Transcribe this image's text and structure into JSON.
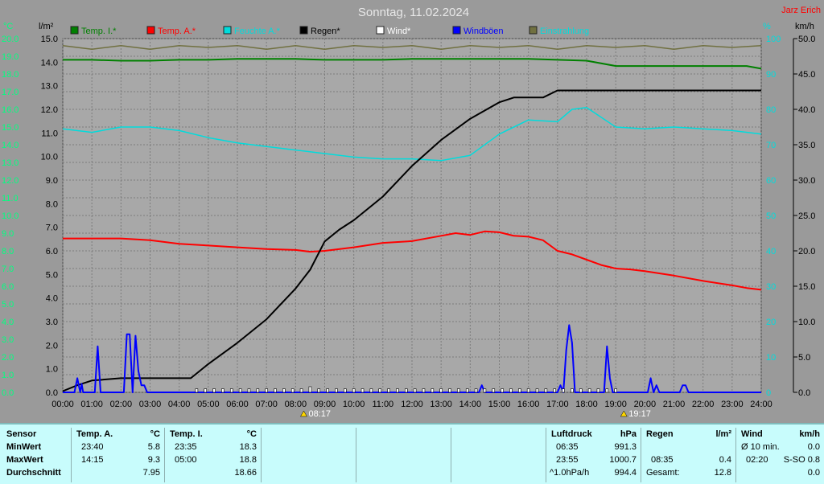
{
  "title": "Sonntag, 11.02.2024",
  "brand": "Jarz Erich",
  "colors": {
    "temp_i": "#008000",
    "temp_a": "#ff0000",
    "feuchte": "#00dcdc",
    "regen": "#000000",
    "wind": "#ffffff",
    "windboeen": "#0000ff",
    "einstrahlung": "#707040",
    "plot_bg": "#a8a8a8",
    "grid": "#7c7c7c"
  },
  "chart_data": {
    "type": "line",
    "title": "Sonntag, 11.02.2024",
    "x_range": [
      0,
      24
    ],
    "x_ticks": [
      "00:00",
      "01:00",
      "02:00",
      "03:00",
      "04:00",
      "05:00",
      "06:00",
      "07:00",
      "08:00",
      "09:00",
      "10:00",
      "11:00",
      "12:00",
      "13:00",
      "14:00",
      "15:00",
      "16:00",
      "17:00",
      "18:00",
      "19:00",
      "20:00",
      "21:00",
      "22:00",
      "23:00",
      "24:00"
    ],
    "axes": {
      "temp_c": {
        "unit": "°C",
        "range": [
          0,
          20
        ],
        "ticks": [
          "0.0",
          "1.0",
          "2.0",
          "3.0",
          "4.0",
          "5.0",
          "6.0",
          "7.0",
          "8.0",
          "9.0",
          "10.0",
          "11.0",
          "12.0",
          "13.0",
          "14.0",
          "15.0",
          "16.0",
          "17.0",
          "18.0",
          "19.0",
          "20.0"
        ]
      },
      "rain_lm2": {
        "unit": "l/m²",
        "range": [
          0,
          15
        ],
        "ticks": [
          "0.0",
          "1.0",
          "2.0",
          "3.0",
          "4.0",
          "5.0",
          "6.0",
          "7.0",
          "8.0",
          "9.0",
          "10.0",
          "11.0",
          "12.0",
          "13.0",
          "14.0",
          "15.0"
        ]
      },
      "humidity_pct": {
        "unit": "%",
        "range": [
          0,
          100
        ],
        "ticks": [
          "0",
          "10",
          "20",
          "30",
          "40",
          "50",
          "60",
          "70",
          "80",
          "90",
          "100"
        ]
      },
      "wind_kmh": {
        "unit": "km/h",
        "range": [
          0,
          50
        ],
        "ticks": [
          "0.0",
          "5.0",
          "10.0",
          "15.0",
          "20.0",
          "25.0",
          "30.0",
          "35.0",
          "40.0",
          "45.0",
          "50.0"
        ]
      }
    },
    "grid": true,
    "legend_position": "top",
    "series": [
      {
        "name": "Temp. I.*",
        "axis": "temp_c",
        "color": "#008000",
        "points": [
          [
            0,
            18.8
          ],
          [
            1,
            18.8
          ],
          [
            2,
            18.75
          ],
          [
            3,
            18.75
          ],
          [
            4,
            18.8
          ],
          [
            5,
            18.8
          ],
          [
            6,
            18.85
          ],
          [
            7,
            18.85
          ],
          [
            8,
            18.85
          ],
          [
            9,
            18.8
          ],
          [
            10,
            18.8
          ],
          [
            11,
            18.8
          ],
          [
            12,
            18.85
          ],
          [
            13,
            18.85
          ],
          [
            14,
            18.85
          ],
          [
            15,
            18.85
          ],
          [
            16,
            18.85
          ],
          [
            17,
            18.8
          ],
          [
            18,
            18.75
          ],
          [
            19,
            18.45
          ],
          [
            20,
            18.45
          ],
          [
            21,
            18.45
          ],
          [
            22,
            18.45
          ],
          [
            23,
            18.45
          ],
          [
            23.5,
            18.45
          ],
          [
            24,
            18.3
          ]
        ]
      },
      {
        "name": "Temp. A.*",
        "axis": "temp_c",
        "color": "#ff0000",
        "points": [
          [
            0,
            8.7
          ],
          [
            1,
            8.7
          ],
          [
            2,
            8.7
          ],
          [
            3,
            8.6
          ],
          [
            4,
            8.4
          ],
          [
            5,
            8.3
          ],
          [
            6,
            8.2
          ],
          [
            7,
            8.1
          ],
          [
            8,
            8.05
          ],
          [
            8.5,
            7.95
          ],
          [
            9,
            8.0
          ],
          [
            10,
            8.2
          ],
          [
            11,
            8.45
          ],
          [
            12,
            8.55
          ],
          [
            13,
            8.85
          ],
          [
            13.5,
            9.0
          ],
          [
            14,
            8.9
          ],
          [
            14.5,
            9.1
          ],
          [
            15,
            9.05
          ],
          [
            15.5,
            8.85
          ],
          [
            16,
            8.8
          ],
          [
            16.5,
            8.6
          ],
          [
            17,
            8.0
          ],
          [
            17.5,
            7.8
          ],
          [
            18,
            7.5
          ],
          [
            18.5,
            7.2
          ],
          [
            19,
            7.0
          ],
          [
            19.5,
            6.95
          ],
          [
            20,
            6.85
          ],
          [
            21,
            6.6
          ],
          [
            22,
            6.3
          ],
          [
            23,
            6.05
          ],
          [
            23.5,
            5.9
          ],
          [
            24,
            5.8
          ]
        ]
      },
      {
        "name": "Feuchte A.*",
        "axis": "humidity_pct",
        "color": "#00dcdc",
        "points": [
          [
            0,
            74.5
          ],
          [
            1,
            73.5
          ],
          [
            2,
            75
          ],
          [
            3,
            75
          ],
          [
            4,
            74
          ],
          [
            5,
            72
          ],
          [
            6,
            70.5
          ],
          [
            7,
            69.5
          ],
          [
            8,
            68.5
          ],
          [
            9,
            67.5
          ],
          [
            10,
            66.5
          ],
          [
            11,
            66
          ],
          [
            12,
            66
          ],
          [
            13,
            65.5
          ],
          [
            14,
            67
          ],
          [
            15,
            73
          ],
          [
            16,
            77
          ],
          [
            17,
            76.5
          ],
          [
            17.5,
            80
          ],
          [
            18,
            80.5
          ],
          [
            19,
            75
          ],
          [
            20,
            74.5
          ],
          [
            21,
            75
          ],
          [
            22,
            74.5
          ],
          [
            23,
            74
          ],
          [
            24,
            73
          ]
        ]
      },
      {
        "name": "Regen*",
        "axis": "rain_lm2",
        "color": "#000000",
        "points": [
          [
            0,
            0.05
          ],
          [
            0.5,
            0.3
          ],
          [
            1,
            0.5
          ],
          [
            2,
            0.6
          ],
          [
            3,
            0.6
          ],
          [
            4,
            0.6
          ],
          [
            4.4,
            0.6
          ],
          [
            5,
            1.2
          ],
          [
            6,
            2.1
          ],
          [
            7,
            3.1
          ],
          [
            8,
            4.4
          ],
          [
            8.5,
            5.2
          ],
          [
            9,
            6.4
          ],
          [
            9.5,
            6.9
          ],
          [
            10,
            7.3
          ],
          [
            11,
            8.3
          ],
          [
            12,
            9.6
          ],
          [
            13,
            10.7
          ],
          [
            14,
            11.6
          ],
          [
            15,
            12.3
          ],
          [
            15.5,
            12.5
          ],
          [
            16,
            12.5
          ],
          [
            16.5,
            12.5
          ],
          [
            17,
            12.8
          ],
          [
            18,
            12.8
          ],
          [
            19,
            12.8
          ],
          [
            20,
            12.8
          ],
          [
            21,
            12.8
          ],
          [
            22,
            12.8
          ],
          [
            23,
            12.8
          ],
          [
            24,
            12.8
          ]
        ]
      },
      {
        "name": "Wind*",
        "axis": "wind_kmh",
        "color": "#ffffff",
        "bars": [
          [
            4.6,
            0.5
          ],
          [
            4.9,
            0.5
          ],
          [
            5.2,
            0.5
          ],
          [
            5.5,
            0.5
          ],
          [
            5.8,
            0.5
          ],
          [
            6.1,
            0.5
          ],
          [
            6.4,
            0.5
          ],
          [
            6.7,
            0.5
          ],
          [
            7.0,
            0.5
          ],
          [
            7.3,
            0.5
          ],
          [
            7.6,
            0.5
          ],
          [
            7.9,
            0.5
          ],
          [
            8.2,
            0.5
          ],
          [
            8.5,
            0.8
          ],
          [
            8.8,
            0.5
          ],
          [
            9.1,
            0.5
          ],
          [
            9.4,
            0.5
          ],
          [
            9.7,
            0.5
          ],
          [
            10.0,
            0.5
          ],
          [
            10.3,
            0.5
          ],
          [
            10.6,
            0.5
          ],
          [
            10.9,
            0.5
          ],
          [
            11.2,
            0.5
          ],
          [
            11.5,
            0.5
          ],
          [
            11.8,
            0.5
          ],
          [
            12.1,
            0.5
          ],
          [
            12.4,
            0.5
          ],
          [
            12.7,
            0.5
          ],
          [
            13.0,
            0.5
          ],
          [
            13.3,
            0.5
          ],
          [
            13.6,
            0.5
          ],
          [
            13.9,
            0.5
          ],
          [
            14.2,
            0.5
          ],
          [
            14.5,
            0.5
          ],
          [
            14.8,
            0.5
          ],
          [
            15.1,
            0.5
          ],
          [
            15.4,
            0.5
          ],
          [
            15.7,
            0.5
          ],
          [
            16.0,
            0.5
          ],
          [
            16.3,
            0.5
          ],
          [
            16.6,
            0.5
          ],
          [
            16.9,
            0.5
          ],
          [
            17.2,
            0.5
          ],
          [
            17.5,
            0.5
          ],
          [
            17.8,
            0.5
          ],
          [
            18.1,
            0.5
          ],
          [
            18.4,
            0.5
          ],
          [
            18.7,
            0.5
          ],
          [
            19.0,
            0.5
          ]
        ]
      },
      {
        "name": "Windböen",
        "axis": "wind_kmh",
        "color": "#0000ff",
        "points": [
          [
            0,
            0
          ],
          [
            0.4,
            0
          ],
          [
            0.5,
            2.0
          ],
          [
            0.6,
            0
          ],
          [
            0.65,
            1.2
          ],
          [
            0.7,
            0
          ],
          [
            1.1,
            0
          ],
          [
            1.2,
            6.5
          ],
          [
            1.3,
            0
          ],
          [
            2.1,
            0
          ],
          [
            2.2,
            8.2
          ],
          [
            2.3,
            8.2
          ],
          [
            2.4,
            0
          ],
          [
            2.5,
            8.0
          ],
          [
            2.6,
            3
          ],
          [
            2.7,
            1.0
          ],
          [
            2.8,
            1.0
          ],
          [
            2.9,
            0
          ],
          [
            14.3,
            0
          ],
          [
            14.4,
            1.0
          ],
          [
            14.5,
            0
          ],
          [
            17.0,
            0
          ],
          [
            17.1,
            1.0
          ],
          [
            17.2,
            0
          ],
          [
            17.3,
            6
          ],
          [
            17.4,
            9.5
          ],
          [
            17.5,
            7
          ],
          [
            17.6,
            0
          ],
          [
            18.6,
            0
          ],
          [
            18.7,
            6.5
          ],
          [
            18.8,
            2
          ],
          [
            18.9,
            0
          ],
          [
            20.1,
            0
          ],
          [
            20.2,
            2.0
          ],
          [
            20.3,
            0
          ],
          [
            20.4,
            1.0
          ],
          [
            20.5,
            0
          ],
          [
            21.2,
            0
          ],
          [
            21.3,
            1.0
          ],
          [
            21.4,
            1.0
          ],
          [
            21.5,
            0
          ],
          [
            24,
            0
          ]
        ]
      },
      {
        "name": "Einstrahlung",
        "axis": "humidity_pct",
        "color": "#707040",
        "points": [
          [
            0,
            98
          ],
          [
            1,
            97
          ],
          [
            2,
            98
          ],
          [
            3,
            97
          ],
          [
            4,
            98
          ],
          [
            5,
            97.5
          ],
          [
            6,
            98
          ],
          [
            7,
            97
          ],
          [
            8,
            98
          ],
          [
            9,
            97
          ],
          [
            10,
            98
          ],
          [
            11,
            97.5
          ],
          [
            12,
            98
          ],
          [
            13,
            97
          ],
          [
            14,
            98
          ],
          [
            15,
            97.5
          ],
          [
            16,
            98
          ],
          [
            17,
            97
          ],
          [
            18,
            98
          ],
          [
            19,
            97.5
          ],
          [
            20,
            98
          ],
          [
            21,
            97
          ],
          [
            22,
            98
          ],
          [
            23,
            97.5
          ],
          [
            24,
            98
          ]
        ]
      }
    ],
    "annotations": [
      {
        "text": "08:17",
        "x": 8.28,
        "meaning": "sunrise"
      },
      {
        "text": "19:17",
        "x": 19.28,
        "meaning": "sunset"
      }
    ]
  },
  "stats": {
    "sensor": {
      "header": "Sensor",
      "rows": [
        "MinWert",
        "MaxWert",
        "Durchschnitt"
      ]
    },
    "temp_a": {
      "header": "Temp. A.",
      "unit": "°C",
      "rows": [
        [
          "23:40",
          "5.8"
        ],
        [
          "14:15",
          "9.3"
        ],
        [
          "",
          "7.95"
        ]
      ]
    },
    "temp_i": {
      "header": "Temp. I.",
      "unit": "°C",
      "rows": [
        [
          "23:35",
          "18.3"
        ],
        [
          "05:00",
          "18.8"
        ],
        [
          "",
          "18.66"
        ]
      ]
    },
    "luftdruck": {
      "header": "Luftdruck",
      "unit": "hPa",
      "rows": [
        [
          "06:35",
          "991.3"
        ],
        [
          "23:55",
          "1000.7"
        ],
        [
          "^1.0hPa/h",
          "994.4"
        ]
      ]
    },
    "regen": {
      "header": "Regen",
      "unit": "l/m²",
      "rows": [
        [
          "",
          ""
        ],
        [
          "08:35",
          "0.4"
        ],
        [
          "Gesamt:",
          "12.8"
        ]
      ]
    },
    "wind": {
      "header": "Wind",
      "unit": "km/h",
      "rows": [
        [
          "Ø 10 min.",
          "0.0"
        ],
        [
          "02:20",
          "S-SO 0.8"
        ],
        [
          "",
          "0.0"
        ]
      ]
    }
  }
}
